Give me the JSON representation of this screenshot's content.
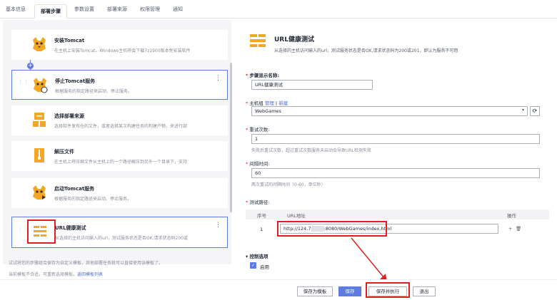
{
  "tabs": [
    "基本信息",
    "部署步骤",
    "参数设置",
    "部署来源",
    "权限管理",
    "通知"
  ],
  "steps": [
    {
      "title": "安装Tomcat",
      "desc": "在主机上安装Tomcat。Windows主机将会下载7z1900版本免安装软件"
    },
    {
      "title": "停止Tomcat服务",
      "desc": "根据服务的指定路径来启动、停止服务。"
    },
    {
      "title": "选择部署来源",
      "desc": "选择软件发布仓的文件，或者选择某次构建任务的构建产物，来进行部"
    },
    {
      "title": "解压文件",
      "desc": "在主机上将压缩文件从主机上的一个路径解压到另外一个目录下，支持"
    },
    {
      "title": "启动Tomcat服务",
      "desc": "根据服务的指定路径来启动、停止服务。"
    },
    {
      "title": "URL健康测试",
      "desc": "从选择的主机访问输入的url，测试服务状态是否OK,请求状态码200或"
    }
  ],
  "left_notes": {
    "line1": "试试将您的步骤组合保存为自定义模板，其他部署任务就可以直接使用该模板了。",
    "line2": "当前模板不合适，可重新选择模板。",
    "link": "返回模板列表"
  },
  "detail": {
    "title": "URL健康测试",
    "desc": "从选择的主机访问输入的url，测试服务状态是否OK,请求状态码为200或201，即认为服务不可用",
    "name_label": "步骤显示名称:",
    "name_value": "URL健康测试",
    "host_label": "主机组",
    "host_manage": "管理",
    "host_sep": "|",
    "host_new": "新建",
    "host_value": "WebGames",
    "retry_label": "重试次数:",
    "retry_value": "1",
    "retry_hint": "失败后重试次数，超过重试次数服务未启动会导致URL检测失败",
    "interval_label": "间隔时间:",
    "interval_value": "60",
    "interval_hint": "两次重试的间隔时间（0-60，单位秒）",
    "path_label": "测试路径:",
    "col_no": "序号",
    "col_url": "URL地址",
    "col_op": "操作",
    "row_no": "1",
    "url_prefix": "http://124.7",
    "url_suffix": ":8080/WebGames/index.html",
    "control_label": "控制选项",
    "enable_label": "启用"
  },
  "footer": {
    "save_template": "保存为模板",
    "save": "保存",
    "save_run": "保存并执行",
    "exit": "退出"
  },
  "colors": {
    "accent": "#5e7ce0",
    "highlight": "#e02020"
  }
}
